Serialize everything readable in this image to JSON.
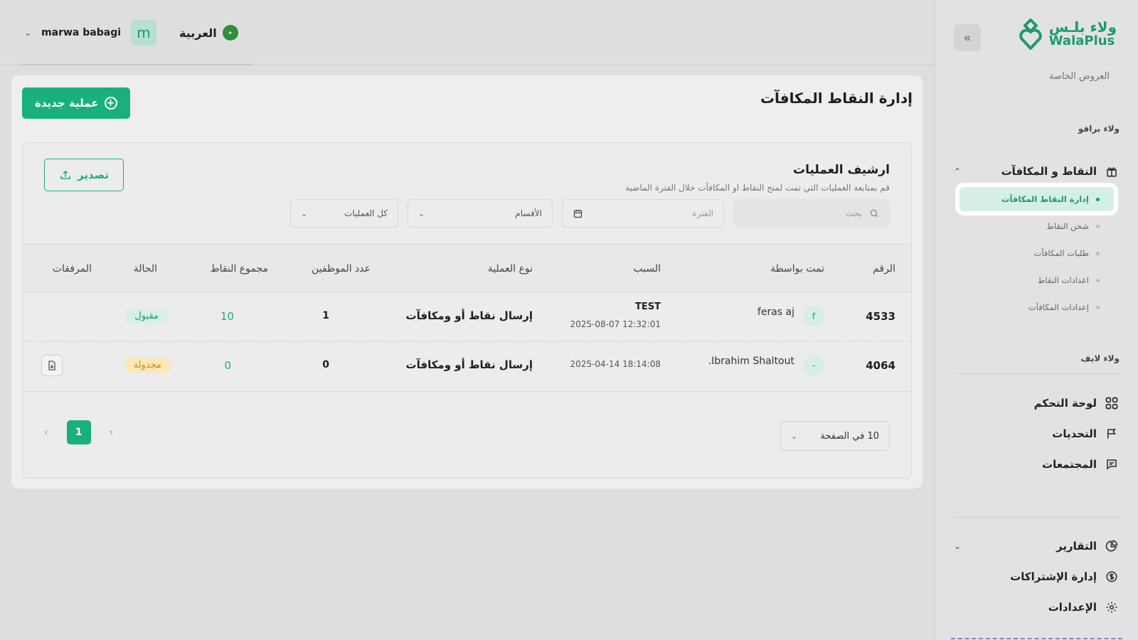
{
  "brand": {
    "arabic": "ولاء بلـس",
    "english": "WalaPlus",
    "color": "#1c9a6d"
  },
  "topbar": {
    "user_name": "marwa babagi",
    "avatar_letter": "m",
    "language": "العربية"
  },
  "sidebar": {
    "cut_item": "العروض الخاصة",
    "section_bravo": "ولاء برافو",
    "points_group": "النقاط و المكافآت",
    "sub_items": [
      {
        "label": "إدارة النقاط المكافآت",
        "active": true
      },
      {
        "label": "شحن النقاط",
        "active": false
      },
      {
        "label": "طلبات المكافآت",
        "active": false
      },
      {
        "label": "اعدادات النقاط",
        "active": false
      },
      {
        "label": "إعدادات المكافآت",
        "active": false
      }
    ],
    "section_life": "ولاء لايف",
    "life_items": [
      "لوحة التحكم",
      "التحديات",
      "المجتمعات"
    ],
    "bottom_items": [
      "التقارير",
      "إدارة الإشتراكات",
      "الإعدادات"
    ]
  },
  "page": {
    "title": "إدارة النقاط المكافآت",
    "new_button": "عملية جديدة",
    "archive_title": "ارشيف العمليات",
    "archive_subtitle": "قم بمتابعة العمليات التي تمت لمنح النقاط او المكافآت خلال الفترة الماضية",
    "export_button": "تصدير",
    "filters": {
      "search_placeholder": "بحث",
      "period_placeholder": "الفترة",
      "departments": "الأقسام",
      "operations": "كل العمليات"
    },
    "table": {
      "headers": {
        "number": "الرقم",
        "by": "تمت بواسطة",
        "reason": "السبب",
        "type": "نوع العملية",
        "employees": "عدد الموظفين",
        "points": "مجموع النقاط",
        "status": "الحالة",
        "attachments": "المرفقات"
      },
      "rows": [
        {
          "number": "4533",
          "avatar": "f",
          "by": "feras aj",
          "reason": "TEST",
          "date": "2025-08-07 12:32:01",
          "type": "إرسال نقاط أو ومكافآت",
          "employees": "1",
          "points": "10",
          "status": "مقبول"
        },
        {
          "number": "4064",
          "avatar": "-",
          "by": "Ibrahim Shaltout.",
          "reason": "",
          "date": "2025-04-14 18:14:08",
          "type": "إرسال نقاط أو ومكافآت",
          "employees": "0",
          "points": "0",
          "status": "مجدولة"
        }
      ]
    },
    "pagination": {
      "current": "1",
      "per_page": "10 في الصفحة"
    }
  }
}
